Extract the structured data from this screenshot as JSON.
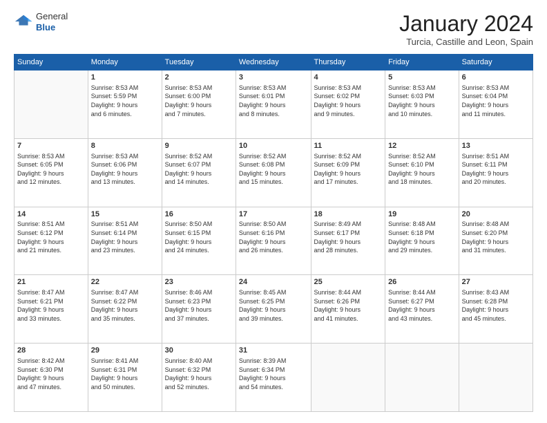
{
  "logo": {
    "general": "General",
    "blue": "Blue"
  },
  "header": {
    "month": "January 2024",
    "location": "Turcia, Castille and Leon, Spain"
  },
  "weekdays": [
    "Sunday",
    "Monday",
    "Tuesday",
    "Wednesday",
    "Thursday",
    "Friday",
    "Saturday"
  ],
  "weeks": [
    [
      {
        "day": "",
        "info": ""
      },
      {
        "day": "1",
        "info": "Sunrise: 8:53 AM\nSunset: 5:59 PM\nDaylight: 9 hours\nand 6 minutes."
      },
      {
        "day": "2",
        "info": "Sunrise: 8:53 AM\nSunset: 6:00 PM\nDaylight: 9 hours\nand 7 minutes."
      },
      {
        "day": "3",
        "info": "Sunrise: 8:53 AM\nSunset: 6:01 PM\nDaylight: 9 hours\nand 8 minutes."
      },
      {
        "day": "4",
        "info": "Sunrise: 8:53 AM\nSunset: 6:02 PM\nDaylight: 9 hours\nand 9 minutes."
      },
      {
        "day": "5",
        "info": "Sunrise: 8:53 AM\nSunset: 6:03 PM\nDaylight: 9 hours\nand 10 minutes."
      },
      {
        "day": "6",
        "info": "Sunrise: 8:53 AM\nSunset: 6:04 PM\nDaylight: 9 hours\nand 11 minutes."
      }
    ],
    [
      {
        "day": "7",
        "info": "Sunrise: 8:53 AM\nSunset: 6:05 PM\nDaylight: 9 hours\nand 12 minutes."
      },
      {
        "day": "8",
        "info": "Sunrise: 8:53 AM\nSunset: 6:06 PM\nDaylight: 9 hours\nand 13 minutes."
      },
      {
        "day": "9",
        "info": "Sunrise: 8:52 AM\nSunset: 6:07 PM\nDaylight: 9 hours\nand 14 minutes."
      },
      {
        "day": "10",
        "info": "Sunrise: 8:52 AM\nSunset: 6:08 PM\nDaylight: 9 hours\nand 15 minutes."
      },
      {
        "day": "11",
        "info": "Sunrise: 8:52 AM\nSunset: 6:09 PM\nDaylight: 9 hours\nand 17 minutes."
      },
      {
        "day": "12",
        "info": "Sunrise: 8:52 AM\nSunset: 6:10 PM\nDaylight: 9 hours\nand 18 minutes."
      },
      {
        "day": "13",
        "info": "Sunrise: 8:51 AM\nSunset: 6:11 PM\nDaylight: 9 hours\nand 20 minutes."
      }
    ],
    [
      {
        "day": "14",
        "info": "Sunrise: 8:51 AM\nSunset: 6:12 PM\nDaylight: 9 hours\nand 21 minutes."
      },
      {
        "day": "15",
        "info": "Sunrise: 8:51 AM\nSunset: 6:14 PM\nDaylight: 9 hours\nand 23 minutes."
      },
      {
        "day": "16",
        "info": "Sunrise: 8:50 AM\nSunset: 6:15 PM\nDaylight: 9 hours\nand 24 minutes."
      },
      {
        "day": "17",
        "info": "Sunrise: 8:50 AM\nSunset: 6:16 PM\nDaylight: 9 hours\nand 26 minutes."
      },
      {
        "day": "18",
        "info": "Sunrise: 8:49 AM\nSunset: 6:17 PM\nDaylight: 9 hours\nand 28 minutes."
      },
      {
        "day": "19",
        "info": "Sunrise: 8:48 AM\nSunset: 6:18 PM\nDaylight: 9 hours\nand 29 minutes."
      },
      {
        "day": "20",
        "info": "Sunrise: 8:48 AM\nSunset: 6:20 PM\nDaylight: 9 hours\nand 31 minutes."
      }
    ],
    [
      {
        "day": "21",
        "info": "Sunrise: 8:47 AM\nSunset: 6:21 PM\nDaylight: 9 hours\nand 33 minutes."
      },
      {
        "day": "22",
        "info": "Sunrise: 8:47 AM\nSunset: 6:22 PM\nDaylight: 9 hours\nand 35 minutes."
      },
      {
        "day": "23",
        "info": "Sunrise: 8:46 AM\nSunset: 6:23 PM\nDaylight: 9 hours\nand 37 minutes."
      },
      {
        "day": "24",
        "info": "Sunrise: 8:45 AM\nSunset: 6:25 PM\nDaylight: 9 hours\nand 39 minutes."
      },
      {
        "day": "25",
        "info": "Sunrise: 8:44 AM\nSunset: 6:26 PM\nDaylight: 9 hours\nand 41 minutes."
      },
      {
        "day": "26",
        "info": "Sunrise: 8:44 AM\nSunset: 6:27 PM\nDaylight: 9 hours\nand 43 minutes."
      },
      {
        "day": "27",
        "info": "Sunrise: 8:43 AM\nSunset: 6:28 PM\nDaylight: 9 hours\nand 45 minutes."
      }
    ],
    [
      {
        "day": "28",
        "info": "Sunrise: 8:42 AM\nSunset: 6:30 PM\nDaylight: 9 hours\nand 47 minutes."
      },
      {
        "day": "29",
        "info": "Sunrise: 8:41 AM\nSunset: 6:31 PM\nDaylight: 9 hours\nand 50 minutes."
      },
      {
        "day": "30",
        "info": "Sunrise: 8:40 AM\nSunset: 6:32 PM\nDaylight: 9 hours\nand 52 minutes."
      },
      {
        "day": "31",
        "info": "Sunrise: 8:39 AM\nSunset: 6:34 PM\nDaylight: 9 hours\nand 54 minutes."
      },
      {
        "day": "",
        "info": ""
      },
      {
        "day": "",
        "info": ""
      },
      {
        "day": "",
        "info": ""
      }
    ]
  ]
}
